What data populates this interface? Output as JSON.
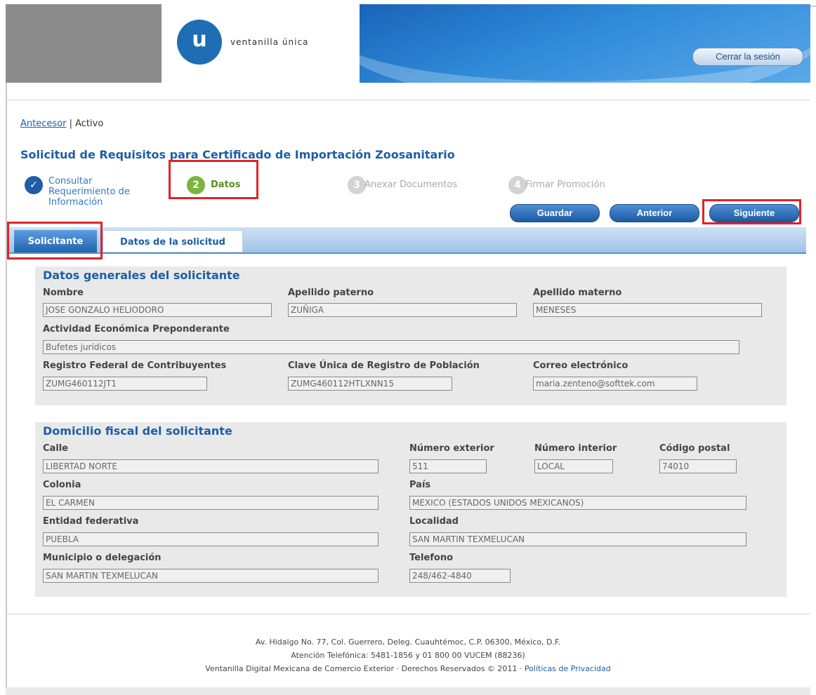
{
  "header": {
    "logo_letter": "u",
    "logo_text": "ventanilla única",
    "logout_label": "Cerrar la sesión"
  },
  "breadcrumb": {
    "link": "Antecesor",
    "separator": " | ",
    "current": "Activo"
  },
  "page_title": "Solicitud de Requisitos para Certificado de Importación Zoosanitario",
  "steps": [
    {
      "num": "✓",
      "label": "Consultar Requerimiento de Información",
      "state": "done"
    },
    {
      "num": "2",
      "label": "Datos",
      "state": "active"
    },
    {
      "num": "3",
      "label": "Anexar Documentos",
      "state": "pending"
    },
    {
      "num": "4",
      "label": "Firmar Promoción",
      "state": "pending"
    }
  ],
  "actions": {
    "guardar": "Guardar",
    "anterior": "Anterior",
    "siguiente": "Siguiente"
  },
  "tabs": [
    {
      "label": "Solicitante",
      "active": true
    },
    {
      "label": "Datos de la solicitud",
      "active": false
    }
  ],
  "general": {
    "title": "Datos generales del solicitante",
    "nombre_label": "Nombre",
    "nombre": "JOSE GONZALO HELIODORO",
    "paterno_label": "Apellido paterno",
    "paterno": "ZUÑIGA",
    "materno_label": "Apellido materno",
    "materno": "MENESES",
    "actividad_label": "Actividad Económica Preponderante",
    "actividad": "Bufetes jurídicos",
    "rfc_label": "Registro Federal de Contribuyentes",
    "rfc": "ZUMG460112JT1",
    "curp_label": "Clave Única de Registro de Población",
    "curp": "ZUMG460112HTLXNN15",
    "correo_label": "Correo electrónico",
    "correo": "maria.zenteno@softtek.com"
  },
  "domicilio": {
    "title": "Domicilio fiscal del solicitante",
    "calle_label": "Calle",
    "calle": "LIBERTAD NORTE",
    "num_ext_label": "Número exterior",
    "num_ext": "511",
    "num_int_label": "Número interior",
    "num_int": "LOCAL",
    "cp_label": "Código postal",
    "cp": "74010",
    "colonia_label": "Colonia",
    "colonia": "EL CARMEN",
    "pais_label": "País",
    "pais": "MEXICO (ESTADOS UNIDOS MEXICANOS)",
    "entidad_label": "Entidad federativa",
    "entidad": "PUEBLA",
    "localidad_label": "Localidad",
    "localidad": "SAN MARTIN TEXMELUCAN",
    "municipio_label": "Municipio o delegación",
    "municipio": "SAN MARTIN TEXMELUCAN",
    "telefono_label": "Telefono",
    "telefono": "248/462-4840"
  },
  "footer": {
    "line1": "Av. Hidalgo No. 77, Col. Guerrero, Deleg. Cuauhtémoc, C.P. 06300, México, D.F.",
    "line2": "Atención Telefónica: 5481-1856 y 01 800 00 VUCEM (88236)",
    "line3": "Ventanilla Digital Mexicana de Comercio Exterior · Derechos Reservados © 2011 · ",
    "privacy_link": "Políticas de Privacidad"
  },
  "colors": {
    "brand_blue": "#1b5ea8",
    "highlight_red": "#e0222a",
    "active_step_green": "#7cb43c"
  }
}
